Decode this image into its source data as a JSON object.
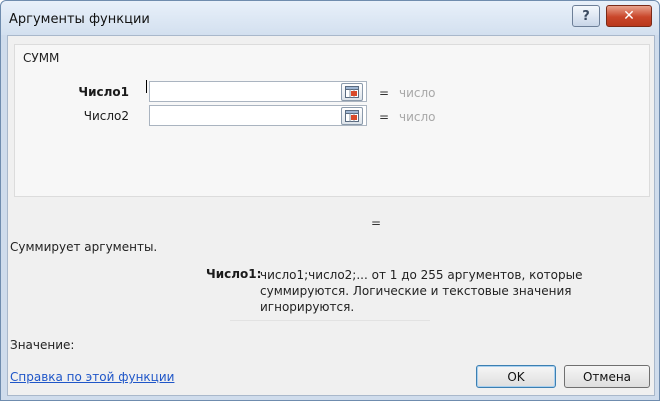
{
  "window": {
    "title": "Аргументы функции",
    "help_glyph": "?",
    "close_glyph": "✕"
  },
  "function": {
    "name": "СУММ",
    "args": [
      {
        "label": "Число1",
        "value": "",
        "result_hint": "число",
        "bold": true
      },
      {
        "label": "Число2",
        "value": "",
        "result_hint": "число",
        "bold": false
      }
    ],
    "equals_glyph": "=",
    "result_equals": "=",
    "description": "Суммирует аргументы.",
    "arg_description_label": "Число1:",
    "arg_description_text": "число1;число2;... от 1 до 255 аргументов, которые суммируются. Логические и текстовые значения игнорируются."
  },
  "footer": {
    "value_label": "Значение:",
    "help_link": "Справка по этой функции",
    "ok_label": "OK",
    "cancel_label": "Отмена"
  },
  "icons": {
    "ref_button_icon": "range-select-icon"
  },
  "colors": {
    "close_red": "#c9462a",
    "link_blue": "#1f56c8",
    "hint_gray": "#a8a8a8"
  }
}
